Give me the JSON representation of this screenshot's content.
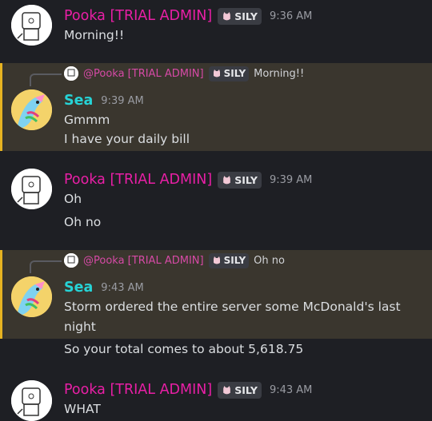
{
  "messages": [
    {
      "author": "Pooka [TRIAL ADMIN]",
      "badge": "SILY",
      "time": "9:36 AM",
      "lines": [
        "Morning!!"
      ]
    },
    {
      "reply_to": {
        "author": "@Pooka [TRIAL ADMIN]",
        "badge": "SILY",
        "text": "Morning!!"
      },
      "author": "Sea",
      "time": "9:39 AM",
      "lines": [
        "Gmmm",
        "I have your daily bill"
      ]
    },
    {
      "author": "Pooka [TRIAL ADMIN]",
      "badge": "SILY",
      "time": "9:39 AM",
      "lines": [
        "Oh",
        "Oh no"
      ]
    },
    {
      "reply_to": {
        "author": "@Pooka [TRIAL ADMIN]",
        "badge": "SILY",
        "text": "Oh no"
      },
      "author": "Sea",
      "time": "9:43 AM",
      "lines": [
        "Storm ordered the entire server some McDonald's last",
        "night",
        "So your total comes to about 5,618.75"
      ]
    },
    {
      "author": "Pooka [TRIAL ADMIN]",
      "badge": "SILY",
      "time": "9:43 AM",
      "lines": [
        "WHAT"
      ]
    }
  ],
  "colors": {
    "background": "#1e1f24",
    "highlight": "#3a362e",
    "highlight_bar": "#e7b321",
    "pooka_name": "#e91fa6",
    "sea_name": "#26d3d6"
  },
  "icons": {
    "badge": "cat-icon",
    "pooka_avatar": "sketch-robot-avatar",
    "sea_avatar": "rainbow-unicorn-avatar"
  }
}
